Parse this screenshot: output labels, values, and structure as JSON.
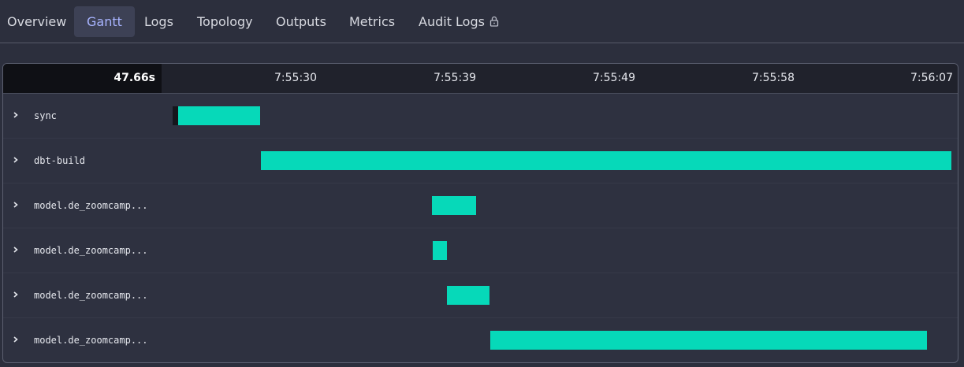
{
  "tabs": [
    {
      "label": "Overview",
      "active": false
    },
    {
      "label": "Gantt",
      "active": true
    },
    {
      "label": "Logs",
      "active": false
    },
    {
      "label": "Topology",
      "active": false
    },
    {
      "label": "Outputs",
      "active": false
    },
    {
      "label": "Metrics",
      "active": false
    },
    {
      "label": "Audit Logs",
      "active": false,
      "icon": "lock-icon"
    }
  ],
  "gantt": {
    "duration": "47.66s",
    "ticks": [
      "7:55:30",
      "7:55:39",
      "7:55:49",
      "7:55:58",
      "7:56:07"
    ],
    "colors": {
      "bar": "#06d9b9",
      "queued": "#15161c",
      "active_tab": "#a8b4ff"
    },
    "rows": [
      {
        "label": "sync"
      },
      {
        "label": "dbt-build"
      },
      {
        "label": "model.de_zoomcamp..."
      },
      {
        "label": "model.de_zoomcamp..."
      },
      {
        "label": "model.de_zoomcamp..."
      },
      {
        "label": "model.de_zoomcamp..."
      }
    ]
  }
}
